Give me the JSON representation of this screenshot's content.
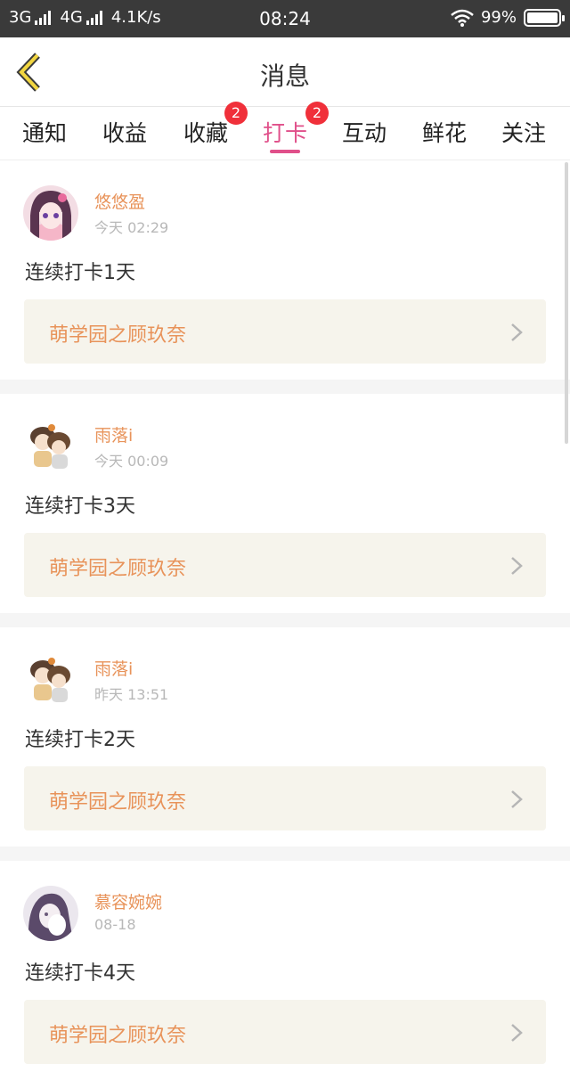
{
  "status_bar": {
    "network_left": "3G",
    "network_right": "4G",
    "speed": "4.1K/s",
    "time": "08:24",
    "battery": "99%",
    "battery_level": 0.99
  },
  "header": {
    "title": "消息"
  },
  "tabs": [
    {
      "label": "通知",
      "badge": ""
    },
    {
      "label": "收益",
      "badge": ""
    },
    {
      "label": "收藏",
      "badge": "2"
    },
    {
      "label": "打卡",
      "badge": "2",
      "active": true
    },
    {
      "label": "互动",
      "badge": ""
    },
    {
      "label": "鲜花",
      "badge": ""
    },
    {
      "label": "关注",
      "badge": ""
    }
  ],
  "colors": {
    "accent": "#e0508a",
    "username": "#e8935a",
    "badge": "#f0303a",
    "link_bg": "#f6f4ec"
  },
  "items": [
    {
      "user": "悠悠盈",
      "time": "今天 02:29",
      "message": "连续打卡1天",
      "book": "萌学园之顾玖奈"
    },
    {
      "user": "雨落i",
      "time": "今天 00:09",
      "message": "连续打卡3天",
      "book": "萌学园之顾玖奈"
    },
    {
      "user": "雨落i",
      "time": "昨天 13:51",
      "message": "连续打卡2天",
      "book": "萌学园之顾玖奈"
    },
    {
      "user": "慕容婉婉",
      "time": "08-18",
      "message": "连续打卡4天",
      "book": "萌学园之顾玖奈"
    }
  ]
}
